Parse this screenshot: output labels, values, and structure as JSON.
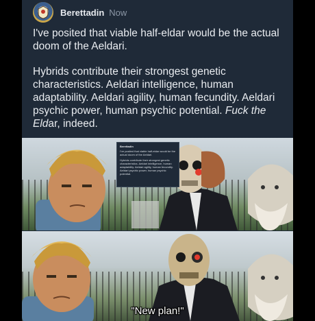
{
  "post": {
    "username": "Berettadin",
    "timestamp": "Now",
    "paragraph1": "I've posited that viable half-eldar would be the actual doom of the Aeldari.",
    "paragraph2_plain": "Hybrids contribute their strongest genetic characteristics. Aeldari intelligence, human adaptability. Aeldari agility, human fecundity. Aeldari psychic power, human psychic potential. ",
    "paragraph2_italic1": "Fuck the",
    "paragraph2_italic2": "Eld",
    "paragraph2_italic_tail": "ar",
    "paragraph2_end": ", indeed."
  },
  "meme": {
    "caption": "\"New plan!\""
  },
  "colors": {
    "card_bg": "#1f2a38",
    "text": "#e9ecf0",
    "muted": "#8c97a6"
  },
  "icons": {
    "avatar": "emblem-avatar-icon"
  }
}
